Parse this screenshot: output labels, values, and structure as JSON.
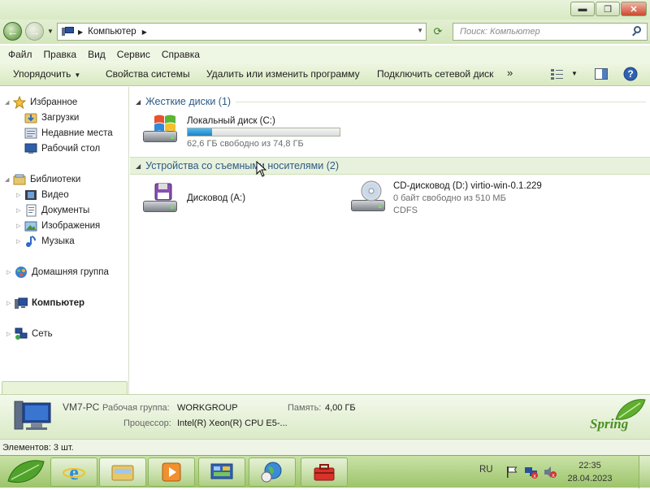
{
  "window": {
    "controls": {
      "minimize": "▬",
      "maximize": "❐",
      "close": "✕"
    }
  },
  "navigation": {
    "address_path": [
      "Компьютер"
    ],
    "search_placeholder": "Поиск: Компьютер"
  },
  "menu": [
    "Файл",
    "Правка",
    "Вид",
    "Сервис",
    "Справка"
  ],
  "toolbar": {
    "organize": "Упорядочить",
    "system_properties": "Свойства системы",
    "uninstall": "Удалить или изменить программу",
    "map_drive": "Подключить сетевой диск",
    "more": "»"
  },
  "sidebar": {
    "favorites": {
      "label": "Избранное",
      "items": [
        "Загрузки",
        "Недавние места",
        "Рабочий стол"
      ]
    },
    "libraries": {
      "label": "Библиотеки",
      "items": [
        "Видео",
        "Документы",
        "Изображения",
        "Музыка"
      ]
    },
    "homegroup": "Домашняя группа",
    "computer": "Компьютер",
    "network": "Сеть"
  },
  "content": {
    "hard_drives_header": "Жесткие диски (1)",
    "removable_header": "Устройства со съемными носителями (2)",
    "local_disk": {
      "name": "Локальный диск (C:)",
      "free_text": "62,6 ГБ свободно из 74,8 ГБ",
      "used_fraction": 0.163
    },
    "floppy": {
      "name": "Дисковод (A:)"
    },
    "cd_drive": {
      "name": "CD-дисковод (D:) virtio-win-0.1.229",
      "free_text": "0 байт свободно из 510 МБ",
      "filesystem": "CDFS"
    }
  },
  "details": {
    "pc_name": "VM7-PC",
    "workgroup_label": "Рабочая группа:",
    "workgroup_value": "WORKGROUP",
    "memory_label": "Память:",
    "memory_value": "4,00 ГБ",
    "cpu_label": "Процессор:",
    "cpu_value": "Intel(R) Xeon(R) CPU E5-...",
    "brand": "Spring"
  },
  "status": {
    "items_count": "Элементов: 3 шт."
  },
  "taskbar": {
    "language": "RU",
    "time": "22:35",
    "date": "28.04.2023"
  },
  "colors": {
    "accent_green": "#9cc46a",
    "header_text": "#2e5a86",
    "disk_bar": "#1e7fc8"
  }
}
